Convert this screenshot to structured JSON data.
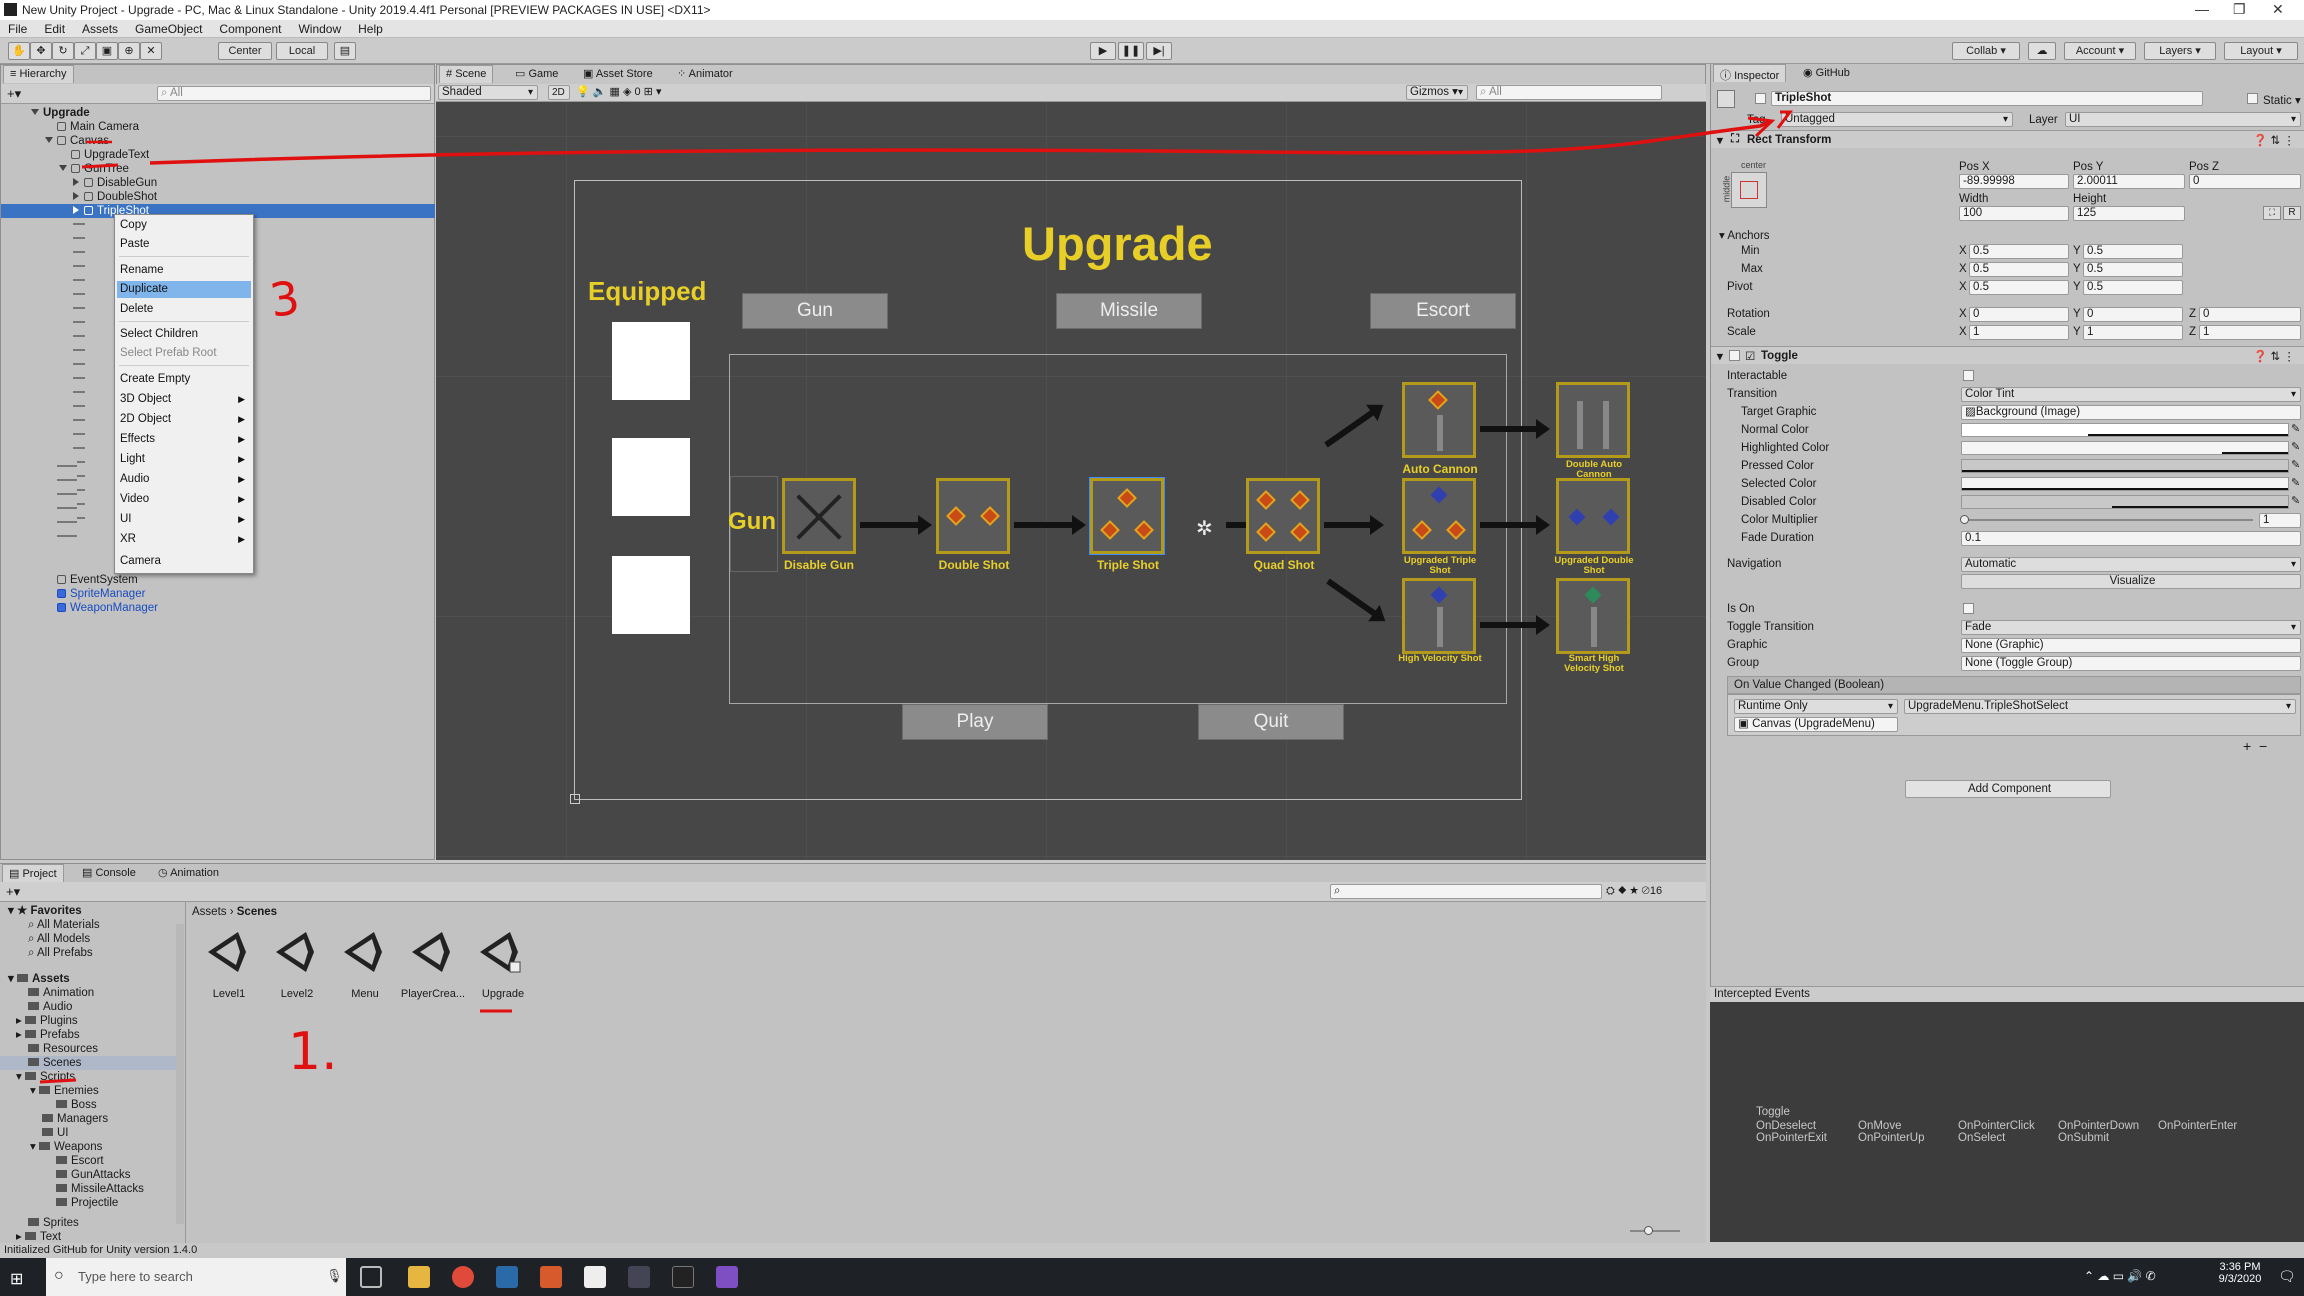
{
  "window": {
    "title": "New Unity Project - Upgrade - PC, Mac & Linux Standalone - Unity 2019.4.4f1 Personal [PREVIEW PACKAGES IN USE] <DX11>"
  },
  "menu": [
    "File",
    "Edit",
    "Assets",
    "GameObject",
    "Component",
    "Window",
    "Help"
  ],
  "toolbar": {
    "pivot": "Center",
    "space": "Local",
    "collab": "Collab ▾",
    "account": "Account ▾",
    "layers": "Layers ▾",
    "layout": "Layout ▾"
  },
  "hierarchy": {
    "tab": "Hierarchy",
    "search_placeholder": "All",
    "rows": [
      {
        "label": "Upgrade",
        "bold": true
      },
      {
        "label": "Main Camera"
      },
      {
        "label": "Canvas"
      },
      {
        "label": "UpgradeText"
      },
      {
        "label": "GunTree"
      },
      {
        "label": "DisableGun"
      },
      {
        "label": "DoubleShot"
      },
      {
        "label": "TripleShot"
      },
      {
        "label": "EventSystem"
      },
      {
        "label": "SpriteManager"
      },
      {
        "label": "WeaponManager"
      }
    ]
  },
  "context_menu": [
    "Copy",
    "Paste",
    "Rename",
    "Duplicate",
    "Delete",
    "Select Children",
    "Select Prefab Root",
    "Create Empty",
    "3D Object",
    "2D Object",
    "Effects",
    "Light",
    "Audio",
    "Video",
    "UI",
    "XR",
    "Camera"
  ],
  "scene_tabs": [
    "Scene",
    "Game",
    "Asset Store",
    "Animator"
  ],
  "scene_toolbar": {
    "shading": "Shaded",
    "mode": "2D",
    "gizmos": "Gizmos ▾",
    "search_placeholder": "All",
    "stat": "0"
  },
  "scene": {
    "title": "Upgrade",
    "equipped": "Equipped",
    "tabs": [
      "Gun",
      "Missile",
      "Escort"
    ],
    "tree_label": "Gun",
    "nodes": [
      "Disable Gun",
      "Double Shot",
      "Triple Shot",
      "Quad Shot",
      "Auto Cannon",
      "Double Auto Cannon",
      "Upgraded Triple Shot",
      "Upgraded Double Shot",
      "High Velocity Shot",
      "Smart High Velocity Shot"
    ],
    "play": "Play",
    "quit": "Quit"
  },
  "annotations": {
    "step1": "1.",
    "step3": "3"
  },
  "inspector": {
    "tabs": [
      "Inspector",
      "GitHub"
    ],
    "object_name": "TripleShot",
    "static": "Static ▾",
    "tag_label": "Tag",
    "tag_value": "Untagged",
    "layer_label": "Layer",
    "layer_value": "UI",
    "rect_transform": {
      "header": "Rect Transform",
      "anchor_h": "center",
      "anchor_v": "middle",
      "posx_label": "Pos X",
      "posy_label": "Pos Y",
      "posz_label": "Pos Z",
      "posx": "-89.99998",
      "posy": "2.00011",
      "posz": "0",
      "width_label": "Width",
      "height_label": "Height",
      "width": "100",
      "height": "125",
      "anchors": "Anchors",
      "min": "Min",
      "max": "Max",
      "pivot": "Pivot",
      "min_x": "0.5",
      "min_y": "0.5",
      "max_x": "0.5",
      "max_y": "0.5",
      "pivot_x": "0.5",
      "pivot_y": "0.5",
      "rotation": "Rotation",
      "scale": "Scale",
      "rot_x": "0",
      "rot_y": "0",
      "rot_z": "0",
      "scale_x": "1",
      "scale_y": "1",
      "scale_z": "1",
      "r_btn": "R"
    },
    "toggle": {
      "header": "Toggle",
      "interactable": "Interactable",
      "transition": "Transition",
      "transition_value": "Color Tint",
      "target_graphic": "Target Graphic",
      "target_graphic_value": "Background (Image)",
      "normal_color": "Normal Color",
      "highlighted_color": "Highlighted Color",
      "pressed_color": "Pressed Color",
      "selected_color": "Selected Color",
      "disabled_color": "Disabled Color",
      "color_multiplier": "Color Multiplier",
      "color_multiplier_value": "1",
      "fade_duration": "Fade Duration",
      "fade_duration_value": "0.1",
      "navigation": "Navigation",
      "navigation_value": "Automatic",
      "visualize": "Visualize",
      "is_on": "Is On",
      "toggle_transition": "Toggle Transition",
      "toggle_transition_value": "Fade",
      "graphic": "Graphic",
      "graphic_value": "None (Graphic)",
      "group": "Group",
      "group_value": "None (Toggle Group)",
      "on_value_changed": "On Value Changed (Boolean)",
      "runtime": "Runtime Only",
      "function": "UpgradeMenu.TripleShotSelect",
      "target": "Canvas (UpgradeMenu)"
    },
    "add_component": "Add Component",
    "intercepted": {
      "title": "Intercepted Events",
      "component": "Toggle",
      "events": [
        "OnDeselect",
        "OnMove",
        "OnPointerClick",
        "OnPointerDown",
        "OnPointerEnter",
        "OnPointerExit",
        "OnPointerUp",
        "OnSelect",
        "OnSubmit"
      ]
    }
  },
  "project": {
    "tabs": [
      "Project",
      "Console",
      "Animation"
    ],
    "count": "16",
    "breadcrumb": [
      "Assets",
      "Scenes"
    ],
    "favorites": [
      "Favorites",
      "All Materials",
      "All Models",
      "All Prefabs"
    ],
    "tree": [
      "Assets",
      "Animation",
      "Audio",
      "Plugins",
      "Prefabs",
      "Resources",
      "Scenes",
      "Scripts",
      "Enemies",
      "Boss",
      "Managers",
      "UI",
      "Weapons",
      "Escort",
      "GunAttacks",
      "MissileAttacks",
      "Projectile",
      "Sprites",
      "Text"
    ],
    "scenes": [
      "Level1",
      "Level2",
      "Menu",
      "PlayerCrea...",
      "Upgrade"
    ]
  },
  "status_text": "Initialized GitHub for Unity version 1.4.0",
  "taskbar": {
    "search_placeholder": "Type here to search",
    "time": "3:36 PM",
    "date": "9/3/2020"
  }
}
